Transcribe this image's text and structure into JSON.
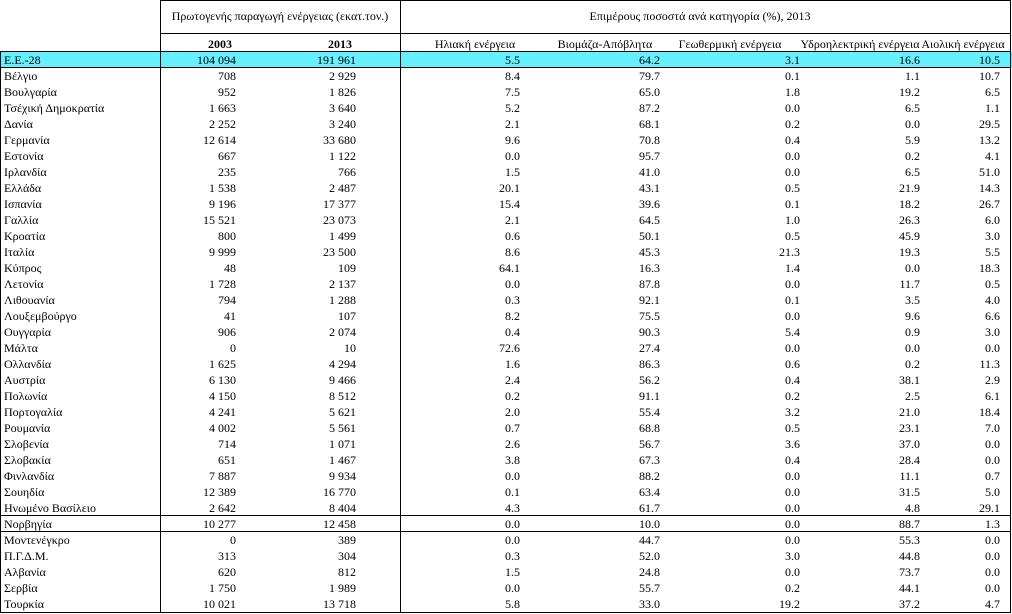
{
  "header": {
    "group1": "Πρωτογενής παραγωγή ενέργειας (εκατ.τον.)",
    "group2": "Επιμέρους ποσοστά ανά κατηγορία (%), 2013",
    "col_2003": "2003",
    "col_2013": "2013",
    "col_solar": "Ηλιακή ενέργεια",
    "col_bio": "Βιομάζα-Απόβλητα",
    "col_geo": "Γεωθερμική ενέργεια",
    "col_hydro": "Υδροηλεκτρική ενέργεια",
    "col_wind": "Αιολική ενέργεια"
  },
  "rows": [
    {
      "name": "Ε.Ε.-28",
      "v2003": "104 094",
      "v2013": "191 961",
      "solar": "5.5",
      "bio": "64.2",
      "geo": "3.1",
      "hydro": "16.6",
      "wind": "10.5"
    },
    {
      "name": "Βέλγιο",
      "v2003": "708",
      "v2013": "2 929",
      "solar": "8.4",
      "bio": "79.7",
      "geo": "0.1",
      "hydro": "1.1",
      "wind": "10.7"
    },
    {
      "name": "Βουλγαρία",
      "v2003": "952",
      "v2013": "1 826",
      "solar": "7.5",
      "bio": "65.0",
      "geo": "1.8",
      "hydro": "19.2",
      "wind": "6.5"
    },
    {
      "name": "Τσέχική Δημοκρατία",
      "v2003": "1 663",
      "v2013": "3 640",
      "solar": "5.2",
      "bio": "87.2",
      "geo": "0.0",
      "hydro": "6.5",
      "wind": "1.1"
    },
    {
      "name": "Δανία",
      "v2003": "2 252",
      "v2013": "3 240",
      "solar": "2.1",
      "bio": "68.1",
      "geo": "0.2",
      "hydro": "0.0",
      "wind": "29.5"
    },
    {
      "name": "Γερμανία",
      "v2003": "12 614",
      "v2013": "33 680",
      "solar": "9.6",
      "bio": "70.8",
      "geo": "0.4",
      "hydro": "5.9",
      "wind": "13.2"
    },
    {
      "name": "Εστονία",
      "v2003": "667",
      "v2013": "1 122",
      "solar": "0.0",
      "bio": "95.7",
      "geo": "0.0",
      "hydro": "0.2",
      "wind": "4.1"
    },
    {
      "name": "Ιρλανδία",
      "v2003": "235",
      "v2013": "766",
      "solar": "1.5",
      "bio": "41.0",
      "geo": "0.0",
      "hydro": "6.5",
      "wind": "51.0"
    },
    {
      "name": "Ελλάδα",
      "v2003": "1 538",
      "v2013": "2 487",
      "solar": "20.1",
      "bio": "43.1",
      "geo": "0.5",
      "hydro": "21.9",
      "wind": "14.3"
    },
    {
      "name": "Ισπανία",
      "v2003": "9 196",
      "v2013": "17 377",
      "solar": "15.4",
      "bio": "39.6",
      "geo": "0.1",
      "hydro": "18.2",
      "wind": "26.7"
    },
    {
      "name": "Γαλλία",
      "v2003": "15 521",
      "v2013": "23 073",
      "solar": "2.1",
      "bio": "64.5",
      "geo": "1.0",
      "hydro": "26.3",
      "wind": "6.0"
    },
    {
      "name": "Κροατία",
      "v2003": "800",
      "v2013": "1 499",
      "solar": "0.6",
      "bio": "50.1",
      "geo": "0.5",
      "hydro": "45.9",
      "wind": "3.0"
    },
    {
      "name": "Ιταλία",
      "v2003": "9 999",
      "v2013": "23 500",
      "solar": "8.6",
      "bio": "45.3",
      "geo": "21.3",
      "hydro": "19.3",
      "wind": "5.5"
    },
    {
      "name": "Κύπρος",
      "v2003": "48",
      "v2013": "109",
      "solar": "64.1",
      "bio": "16.3",
      "geo": "1.4",
      "hydro": "0.0",
      "wind": "18.3"
    },
    {
      "name": "Λετονία",
      "v2003": "1 728",
      "v2013": "2 137",
      "solar": "0.0",
      "bio": "87.8",
      "geo": "0.0",
      "hydro": "11.7",
      "wind": "0.5"
    },
    {
      "name": "Λιθουανία",
      "v2003": "794",
      "v2013": "1 288",
      "solar": "0.3",
      "bio": "92.1",
      "geo": "0.1",
      "hydro": "3.5",
      "wind": "4.0"
    },
    {
      "name": "Λουξεμβούργο",
      "v2003": "41",
      "v2013": "107",
      "solar": "8.2",
      "bio": "75.5",
      "geo": "0.0",
      "hydro": "9.6",
      "wind": "6.6"
    },
    {
      "name": "Ουγγαρία",
      "v2003": "906",
      "v2013": "2 074",
      "solar": "0.4",
      "bio": "90.3",
      "geo": "5.4",
      "hydro": "0.9",
      "wind": "3.0"
    },
    {
      "name": "Μάλτα",
      "v2003": "0",
      "v2013": "10",
      "solar": "72.6",
      "bio": "27.4",
      "geo": "0.0",
      "hydro": "0.0",
      "wind": "0.0"
    },
    {
      "name": "Ολλανδία",
      "v2003": "1 625",
      "v2013": "4 294",
      "solar": "1.6",
      "bio": "86.3",
      "geo": "0.6",
      "hydro": "0.2",
      "wind": "11.3"
    },
    {
      "name": "Αυστρία",
      "v2003": "6 130",
      "v2013": "9 466",
      "solar": "2.4",
      "bio": "56.2",
      "geo": "0.4",
      "hydro": "38.1",
      "wind": "2.9"
    },
    {
      "name": "Πολωνία",
      "v2003": "4 150",
      "v2013": "8 512",
      "solar": "0.2",
      "bio": "91.1",
      "geo": "0.2",
      "hydro": "2.5",
      "wind": "6.1"
    },
    {
      "name": "Πορτογαλία",
      "v2003": "4 241",
      "v2013": "5 621",
      "solar": "2.0",
      "bio": "55.4",
      "geo": "3.2",
      "hydro": "21.0",
      "wind": "18.4"
    },
    {
      "name": "Ρουμανία",
      "v2003": "4 002",
      "v2013": "5 561",
      "solar": "0.7",
      "bio": "68.8",
      "geo": "0.5",
      "hydro": "23.1",
      "wind": "7.0"
    },
    {
      "name": "Σλοβενία",
      "v2003": "714",
      "v2013": "1 071",
      "solar": "2.6",
      "bio": "56.7",
      "geo": "3.6",
      "hydro": "37.0",
      "wind": "0.0"
    },
    {
      "name": "Σλοβακία",
      "v2003": "651",
      "v2013": "1 467",
      "solar": "3.8",
      "bio": "67.3",
      "geo": "0.4",
      "hydro": "28.4",
      "wind": "0.0"
    },
    {
      "name": "Φινλανδία",
      "v2003": "7 887",
      "v2013": "9 934",
      "solar": "0.0",
      "bio": "88.2",
      "geo": "0.0",
      "hydro": "11.1",
      "wind": "0.7"
    },
    {
      "name": "Σουηδία",
      "v2003": "12 389",
      "v2013": "16 770",
      "solar": "0.1",
      "bio": "63.4",
      "geo": "0.0",
      "hydro": "31.5",
      "wind": "5.0"
    },
    {
      "name": "Ηνωμένο Βασίλειο",
      "v2003": "2 642",
      "v2013": "8 404",
      "solar": "4.3",
      "bio": "61.7",
      "geo": "0.0",
      "hydro": "4.8",
      "wind": "29.1"
    },
    {
      "name": "Νορβηγία",
      "v2003": "10 277",
      "v2013": "12 458",
      "solar": "0.0",
      "bio": "10.0",
      "geo": "0.0",
      "hydro": "88.7",
      "wind": "1.3"
    },
    {
      "name": "Μοντενέγκρο",
      "v2003": "0",
      "v2013": "389",
      "solar": "0.0",
      "bio": "44.7",
      "geo": "0.0",
      "hydro": "55.3",
      "wind": "0.0"
    },
    {
      "name": "Π.Γ.Δ.Μ.",
      "v2003": "313",
      "v2013": "304",
      "solar": "0.3",
      "bio": "52.0",
      "geo": "3.0",
      "hydro": "44.8",
      "wind": "0.0"
    },
    {
      "name": "Αλβανία",
      "v2003": "620",
      "v2013": "812",
      "solar": "1.5",
      "bio": "24.8",
      "geo": "0.0",
      "hydro": "73.7",
      "wind": "0.0"
    },
    {
      "name": "Σερβία",
      "v2003": "1 750",
      "v2013": "1 989",
      "solar": "0.0",
      "bio": "55.7",
      "geo": "0.2",
      "hydro": "44.1",
      "wind": "0.0"
    },
    {
      "name": "Τουρκία",
      "v2003": "10 021",
      "v2013": "13 718",
      "solar": "5.8",
      "bio": "33.0",
      "geo": "19.2",
      "hydro": "37.2",
      "wind": "4.7"
    }
  ]
}
